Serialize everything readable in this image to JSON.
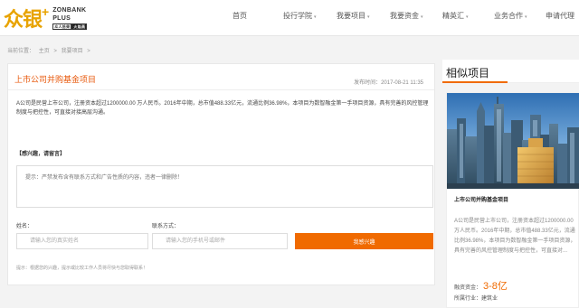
{
  "logo": {
    "cn": "众银",
    "plus": "+",
    "en_line1": "ZONBANK",
    "en_line2": "PLUS",
    "tag_left": "众人拾柴",
    "tag_right": "火焰高"
  },
  "nav": [
    {
      "label": "首页",
      "has_arrow": false
    },
    {
      "label": "投行学院",
      "has_arrow": true
    },
    {
      "label": "我要项目",
      "has_arrow": true
    },
    {
      "label": "我要资金",
      "has_arrow": true
    },
    {
      "label": "精英汇",
      "has_arrow": true
    },
    {
      "label": "业务合作",
      "has_arrow": true
    },
    {
      "label": "申请代理",
      "has_arrow": false
    }
  ],
  "nav_arrow": "▾",
  "breadcrumb": {
    "prefix": "当前位置：",
    "home": "主页",
    "sep": ">",
    "section": "我要项目",
    "sep2": ">"
  },
  "project": {
    "title": "上市公司并购基金项目",
    "publish": "发布时间：2017-08-21 11:35",
    "description": "A公司是民营上市公司，注册资本超过1200000.00 万人民币。2016年中期，总市值488.33亿元，流通比例36.98%，本项目为数智融金第一手项目资源，具有完善的风控管理制度与把控性，可直接对接高层沟通。"
  },
  "form": {
    "interest_label": "【感兴趣，请留言】",
    "message_placeholder": "提示：严禁发布含有联系方式和广告性质的内容，违者一律删除！",
    "name_label": "姓名：",
    "name_placeholder": "请输入您的真实姓名",
    "contact_label": "联系方式：",
    "contact_placeholder": "请输入您的手机号或邮件",
    "submit": "我感兴趣",
    "notice": "提示：根据您的兴趣，提示或比较工作人员将尽快与您取得联系！"
  },
  "sidebar": {
    "title": "相似项目",
    "card": {
      "title": "上市公司并购基金项目",
      "description": "A公司是民营上市公司，注册资本超过1200000.00 万人民币。2016年中期，总市值488.33亿元，流通比例36.98%，本项目为数智融金第一手项目资源，具有完善的风控管理制度与把控性，可直接对...",
      "finance_label": "融资资金：",
      "finance_amount": "3-8亿",
      "industry": "所属行业：建筑业"
    }
  },
  "colors": {
    "accent": "#f06a00",
    "title": "#e8590c",
    "logo": "#e8a300"
  }
}
